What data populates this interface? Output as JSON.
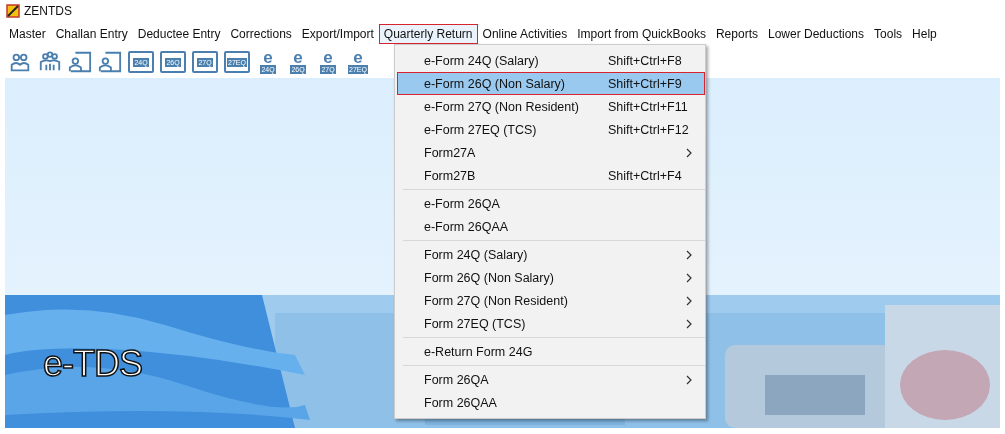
{
  "window": {
    "title": "ZENTDS"
  },
  "menubar": [
    {
      "label": "Master",
      "selected": false
    },
    {
      "label": "Challan Entry",
      "selected": false
    },
    {
      "label": "Deductee Entry",
      "selected": false
    },
    {
      "label": "Corrections",
      "selected": false
    },
    {
      "label": "Export/Import",
      "selected": false
    },
    {
      "label": "Quarterly Return",
      "selected": true
    },
    {
      "label": "Online Activities",
      "selected": false
    },
    {
      "label": "Import from QuickBooks",
      "selected": false
    },
    {
      "label": "Reports",
      "selected": false
    },
    {
      "label": "Lower Deductions",
      "selected": false
    },
    {
      "label": "Tools",
      "selected": false
    },
    {
      "label": "Help",
      "selected": false
    }
  ],
  "toolbar": [
    {
      "kind": "person"
    },
    {
      "kind": "group"
    },
    {
      "kind": "frame"
    },
    {
      "kind": "frame"
    },
    {
      "kind": "form",
      "label": "24Q"
    },
    {
      "kind": "form",
      "label": "26Q"
    },
    {
      "kind": "form",
      "label": "27Q"
    },
    {
      "kind": "form",
      "label": "27EQ"
    },
    {
      "kind": "eform",
      "letter": "e",
      "label": "24Q"
    },
    {
      "kind": "eform",
      "letter": "e",
      "label": "26Q"
    },
    {
      "kind": "eform",
      "letter": "e",
      "label": "27Q"
    },
    {
      "kind": "eform",
      "letter": "e",
      "label": "27EQ"
    }
  ],
  "dropdown": {
    "groups": [
      [
        {
          "label": "e-Form 24Q (Salary)",
          "shortcut": "Shift+Ctrl+F8",
          "submenu": false,
          "selected": false
        },
        {
          "label": "e-Form 26Q (Non Salary)",
          "shortcut": "Shift+Ctrl+F9",
          "submenu": false,
          "selected": true
        },
        {
          "label": "e-Form 27Q (Non Resident)",
          "shortcut": "Shift+Ctrl+F11",
          "submenu": false,
          "selected": false
        },
        {
          "label": "e-Form 27EQ (TCS)",
          "shortcut": "Shift+Ctrl+F12",
          "submenu": false,
          "selected": false
        },
        {
          "label": "Form27A",
          "submenu": true,
          "selected": false
        },
        {
          "label": "Form27B",
          "shortcut": "Shift+Ctrl+F4",
          "submenu": false,
          "selected": false
        }
      ],
      [
        {
          "label": "e-Form 26QA",
          "submenu": false,
          "selected": false
        },
        {
          "label": "e-Form 26QAA",
          "submenu": false,
          "selected": false
        }
      ],
      [
        {
          "label": "Form 24Q (Salary)",
          "submenu": true,
          "selected": false
        },
        {
          "label": "Form 26Q (Non Salary)",
          "submenu": true,
          "selected": false
        },
        {
          "label": "Form 27Q (Non Resident)",
          "submenu": true,
          "selected": false
        },
        {
          "label": "Form 27EQ (TCS)",
          "submenu": true,
          "selected": false
        }
      ],
      [
        {
          "label": "e-Return Form 24G",
          "submenu": false,
          "selected": false
        }
      ],
      [
        {
          "label": "Form 26QA",
          "submenu": true,
          "selected": false
        },
        {
          "label": "Form 26QAA",
          "submenu": false,
          "selected": false
        }
      ]
    ]
  },
  "banner": {
    "kind": "picture",
    "caption": "e-TDS"
  }
}
